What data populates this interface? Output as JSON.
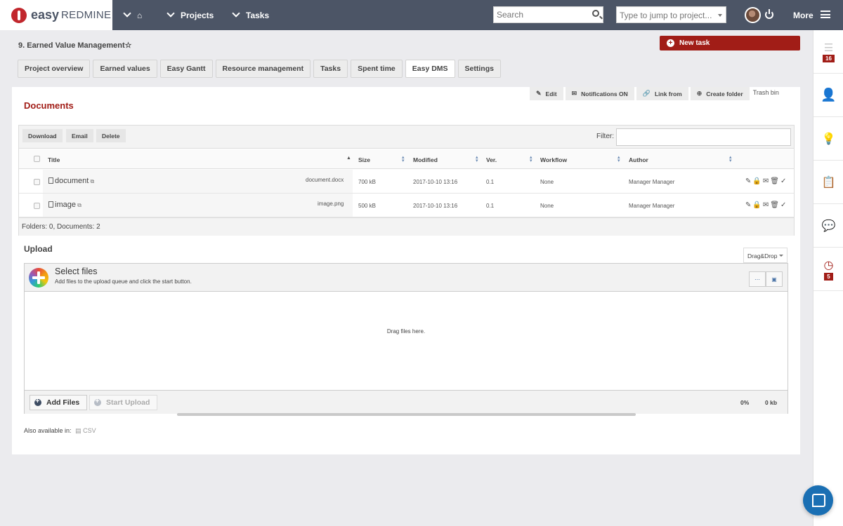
{
  "app": {
    "logo_main": "easy",
    "logo_sub": "REDMINE"
  },
  "topbar": {
    "projects_label": "Projects",
    "tasks_label": "Tasks",
    "search_placeholder": "Search",
    "jump_placeholder": "Type to jump to project...",
    "more_label": "More"
  },
  "sidebar": {
    "badge_activity": "16",
    "badge_time": "5"
  },
  "project": {
    "title": "9. Earned Value Management",
    "new_task_label": "New task"
  },
  "tabs": [
    {
      "label": "Project overview"
    },
    {
      "label": "Earned values"
    },
    {
      "label": "Easy Gantt"
    },
    {
      "label": "Resource management"
    },
    {
      "label": "Tasks"
    },
    {
      "label": "Spent time"
    },
    {
      "label": "Easy DMS"
    },
    {
      "label": "Settings"
    }
  ],
  "documents": {
    "title": "Documents",
    "actions": {
      "edit": "Edit",
      "notifications": "Notifications ON",
      "link_from": "Link from",
      "create_folder": "Create folder",
      "trash_bin": "Trash bin"
    },
    "toolbar": {
      "download": "Download",
      "email": "Email",
      "delete": "Delete",
      "filter_label": "Filter:"
    },
    "columns": {
      "title": "Title",
      "size": "Size",
      "modified": "Modified",
      "version": "Ver.",
      "workflow": "Workflow",
      "author": "Author"
    },
    "rows": [
      {
        "name": "document",
        "filename": "document.docx",
        "size": "700 kB",
        "modified": "2017-10-10 13:16",
        "version": "0.1",
        "workflow": "None",
        "author": "Manager Manager"
      },
      {
        "name": "image",
        "filename": "image.png",
        "size": "500 kB",
        "modified": "2017-10-10 13:16",
        "version": "0.1",
        "workflow": "None",
        "author": "Manager Manager"
      }
    ],
    "summary": "Folders: 0, Documents: 2"
  },
  "upload": {
    "title": "Upload",
    "mode": "Drag&Drop",
    "select_title": "Select files",
    "select_desc": "Add files to the upload queue and click the start button.",
    "drop_text": "Drag files here.",
    "add_files": "Add Files",
    "start_upload": "Start Upload",
    "progress": "0%",
    "total_size": "0 kb"
  },
  "footer": {
    "also_label": "Also available in:",
    "csv_label": "CSV"
  }
}
